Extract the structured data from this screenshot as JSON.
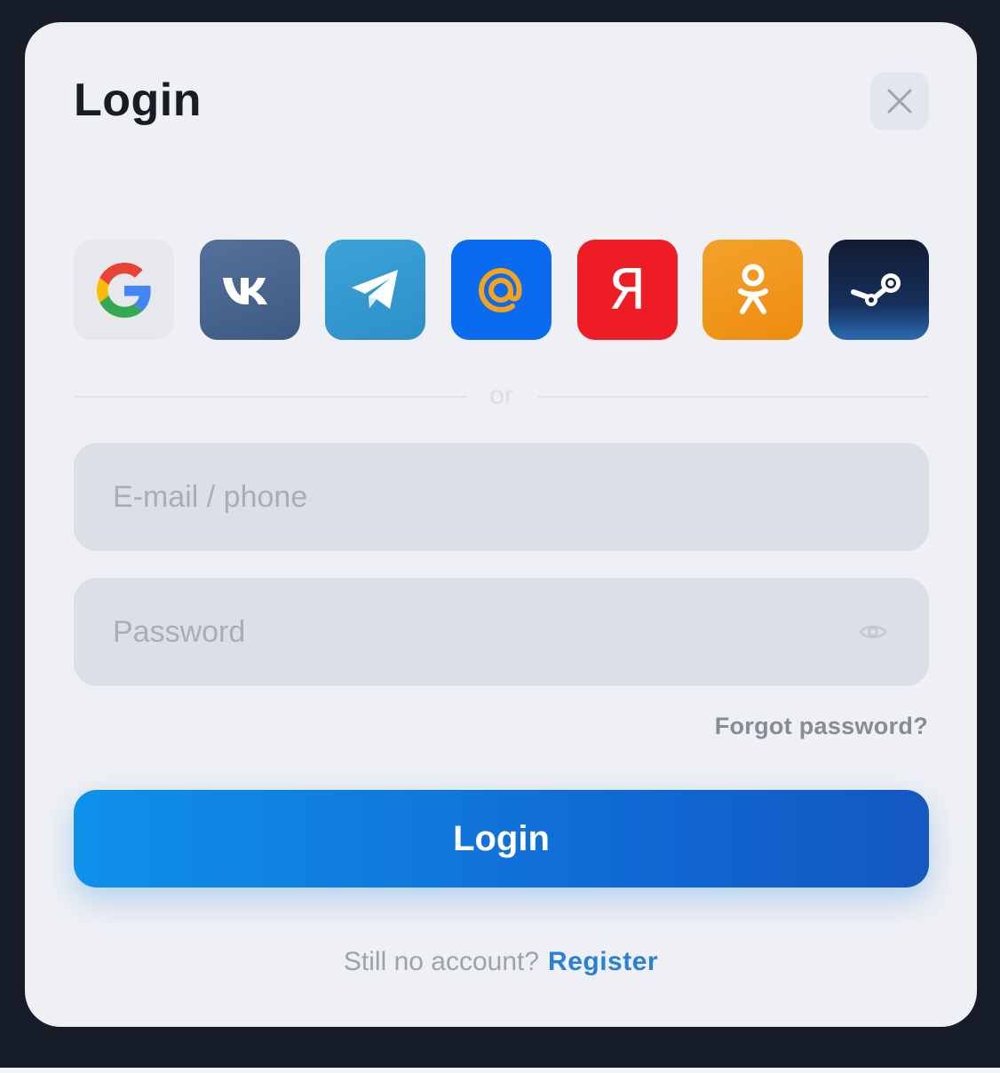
{
  "modal": {
    "title": "Login",
    "close_icon": "close-icon"
  },
  "social_logins": [
    {
      "name": "google",
      "icon": "google-icon"
    },
    {
      "name": "vk",
      "icon": "vk-icon"
    },
    {
      "name": "telegram",
      "icon": "telegram-icon"
    },
    {
      "name": "mail-ru",
      "icon": "at-sign-icon"
    },
    {
      "name": "yandex",
      "icon": "yandex-icon",
      "glyph": "Я"
    },
    {
      "name": "odnoklassniki",
      "icon": "ok-icon"
    },
    {
      "name": "steam",
      "icon": "steam-icon"
    }
  ],
  "divider": {
    "label": "or"
  },
  "form": {
    "email": {
      "value": "",
      "placeholder": "E-mail / phone"
    },
    "password": {
      "value": "",
      "placeholder": "Password",
      "toggle_icon": "eye-icon"
    },
    "forgot_label": "Forgot password?",
    "submit_label": "Login"
  },
  "footer": {
    "question": "Still no account?",
    "register_label": "Register"
  },
  "colors": {
    "backdrop": "#161c28",
    "modal": "#eef0f3",
    "primary": "#1066d2",
    "link": "#2a7fdd"
  }
}
